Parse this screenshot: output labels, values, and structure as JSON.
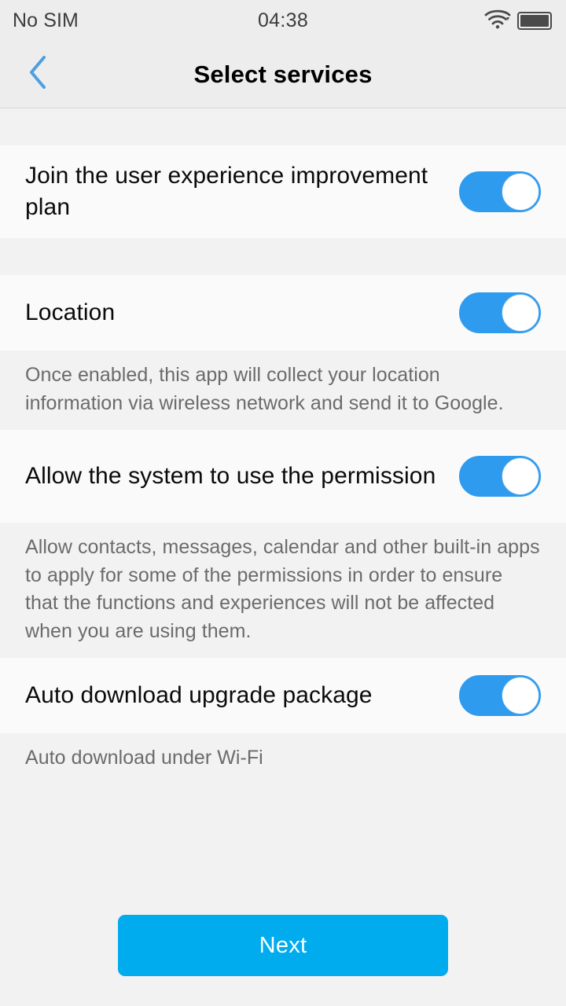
{
  "status_bar": {
    "carrier": "No SIM",
    "time": "04:38",
    "wifi_icon": "wifi-icon",
    "battery_icon": "battery-full-icon"
  },
  "header": {
    "back_icon": "chevron-left-icon",
    "title": "Select services"
  },
  "settings": [
    {
      "label": "Join the user experience improvement plan",
      "toggle_state": "on",
      "description": null
    },
    {
      "label": "Location",
      "toggle_state": "on",
      "description": "Once enabled, this app will collect your location information via wireless network and send it to Google."
    },
    {
      "label": "Allow the system to use the permission",
      "toggle_state": "on",
      "description": "Allow contacts, messages, calendar and other built-in apps to apply for some of the permissions in order to ensure that the functions and experiences will not be affected when you are using them."
    },
    {
      "label": "Auto download upgrade package",
      "toggle_state": "on",
      "description": "Auto download under Wi-Fi"
    }
  ],
  "footer": {
    "next_label": "Next"
  },
  "colors": {
    "toggle_on": "#2F9BEE",
    "button_primary": "#00ACEE",
    "accent_back": "#4D9FE0",
    "row_background": "#FAFAFA",
    "page_background": "#F2F2F2",
    "header_background": "#EDEDED"
  }
}
